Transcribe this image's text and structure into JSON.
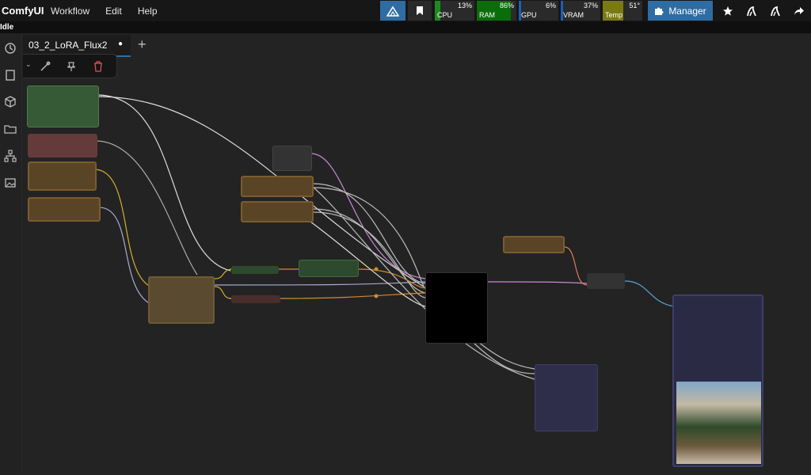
{
  "app": {
    "title": "ComfyUI",
    "status": "Idle"
  },
  "menu": {
    "workflow": "Workflow",
    "edit": "Edit",
    "help": "Help"
  },
  "monitors": [
    {
      "label": "CPU",
      "value": "13%",
      "percent": 13,
      "color": "#1e8a1e"
    },
    {
      "label": "RAM",
      "value": "86%",
      "percent": 86,
      "color": "#0a6d0a"
    },
    {
      "label": "GPU",
      "value": "6%",
      "percent": 6,
      "color": "#1d5fb5"
    },
    {
      "label": "VRAM",
      "value": "37%",
      "percent": 37,
      "color": "#1d5fb5"
    },
    {
      "label": "Temp",
      "value": "51°",
      "percent": 51,
      "color": "#7a7a12"
    }
  ],
  "manager": {
    "label": "Manager"
  },
  "tab": {
    "name": "03_2_LoRA_Flux2",
    "modified_dot": "●",
    "add": "+"
  },
  "colors": {
    "accent": "#2e6da4",
    "topbar": "#171717",
    "canvas": "#232323"
  }
}
